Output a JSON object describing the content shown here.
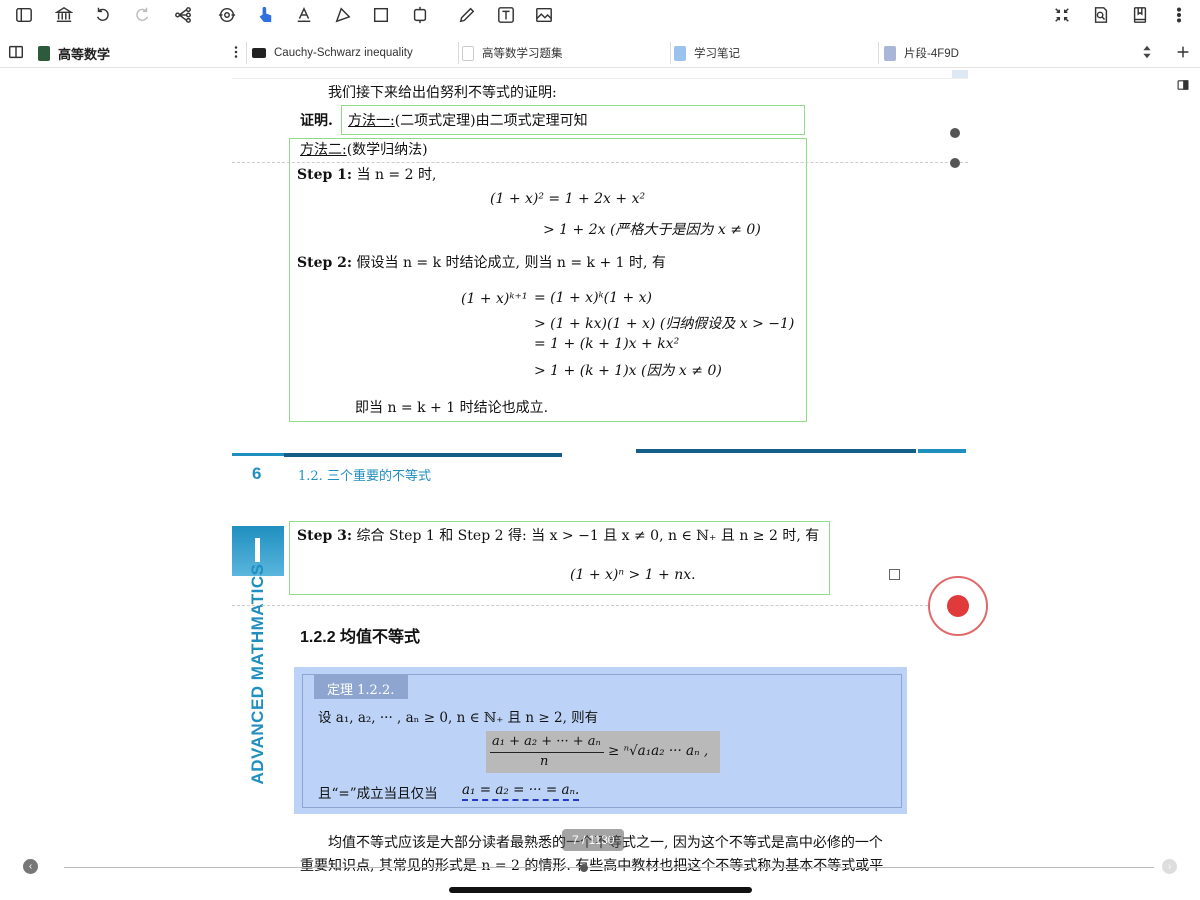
{
  "toolbar": {
    "icons": [
      "sidebar-icon",
      "library-icon",
      "undo-icon",
      "redo-icon",
      "mindmap-icon",
      "sync-icon",
      "hand-tool-icon",
      "text-highlight-icon",
      "shape-select-icon",
      "frame-icon",
      "crop-icon",
      "pen-icon",
      "text-box-icon",
      "image-icon",
      "collapse-icon",
      "search-doc-icon",
      "bookmark-icon",
      "more-icon"
    ],
    "active": "hand-tool-icon",
    "accent": "#2f6fe0"
  },
  "tabbar": {
    "notebook_title": "高等数学",
    "tabs": [
      {
        "label": "Cauchy-Schwarz inequality"
      },
      {
        "label": "高等数学习题集"
      },
      {
        "label": "学习笔记"
      },
      {
        "label": "片段-4F9D"
      }
    ]
  },
  "doc": {
    "intro": "我们接下来给出伯努利不等式的证明:",
    "proof_label": "证明.",
    "method1": "方法一:",
    "method1_rest": "(二项式定理)由二项式定理可知",
    "method2": "方法二:",
    "method2_rest": "(数学归纳法)",
    "step1_label": "Step 1:",
    "step1_text": "当 n = 2 时,",
    "step1_eq1": "(1 + x)² = 1 + 2x + x²",
    "step1_eq2": "> 1 + 2x   (严格大于是因为 x ≠ 0)",
    "step2_label": "Step 2:",
    "step2_text": "假设当 n = k 时结论成立, 则当 n = k + 1 时, 有",
    "step2_lhs": "(1 + x)ᵏ⁺¹",
    "step2_lines": [
      "= (1 + x)ᵏ(1 + x)",
      "> (1 + kx)(1 + x)   (归纳假设及 x > −1)",
      "= 1 + (k + 1)x + kx²",
      "> 1 + (k + 1)x   (因为 x ≠ 0)"
    ],
    "step2_concl": "即当 n = k + 1 时结论也成立.",
    "page_number": "6",
    "section_header": "1.2.  三个重要的不等式",
    "step3_label": "Step 3:",
    "step3_text": "综合 Step 1 和 Step 2 得: 当 x > −1 且 x ≠ 0, n ∈ ℕ₊ 且 n ≥ 2 时, 有",
    "step3_eq": "(1 + x)ⁿ > 1 + nx.",
    "side_label": "ADVANCED MATHMATICS",
    "subsection": "1.2.2    均值不等式",
    "theorem_tag": "定理  1.2.2.",
    "theorem_line1": "设 a₁, a₂, ··· , aₙ ≥ 0, n ∈ ℕ₊ 且 n ≥ 2, 则有",
    "theorem_frac_num": "a₁ + a₂ + ··· + aₙ",
    "theorem_frac_den": "n",
    "theorem_rhs": "≥ ⁿ√a₁a₂ ··· aₙ ,",
    "theorem_line3": "且“=”成立当且仅当",
    "theorem_eq": "a₁ = a₂ = ··· = aₙ.",
    "para1": "均值不等式应该是大部分读者最熟悉的一个不等式之一, 因为这个不等式是高中必修的一个",
    "para2": "重要知识点, 其常见的形式是 n = 2 的情形. 有些高中教材也把这个不等式称为基本不等式或平",
    "page_overlay": "7 / 1130"
  },
  "colors": {
    "green_frame": "#8fdc8a",
    "theorem_bg": "#bcd3f7",
    "header_blue": "#1f8fbf",
    "record_red": "#e03a3a"
  }
}
